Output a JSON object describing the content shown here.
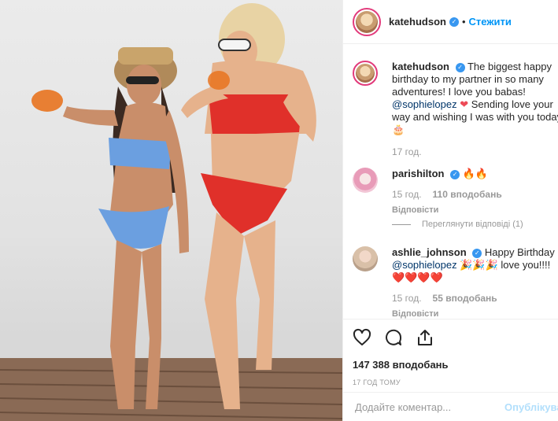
{
  "post": {
    "image_alt": "Two women in bikinis holding drinks against a white wall",
    "author": "katehudson",
    "follow_label": "Стежити"
  },
  "caption": {
    "user": "katehudson",
    "text_1": "The biggest happy birthday to my partner in so many adventures! I love you babas!",
    "mention": "@sophielopez",
    "text_2": "Sending love your way and wishing I was with you today!",
    "emoji_end": "🎂",
    "time": "17 год."
  },
  "comments": [
    {
      "user": "parishilton",
      "text": "🔥🔥",
      "time": "15 год.",
      "likes": "110 вподобань",
      "reply_label": "Відповісти",
      "view_replies": "Переглянути відповіді (1)"
    },
    {
      "user": "ashlie_johnson",
      "text_1": "Happy Birthday",
      "mention": "@sophielopez",
      "text_2": "🎉🎉🎉 love you!!!! ❤️❤️❤️❤️",
      "time": "15 год.",
      "likes": "55 вподобань",
      "reply_label": "Відповісти"
    }
  ],
  "stats": {
    "likes": "147 388 вподобань",
    "time_ago": "17 ГОД ТОМУ"
  },
  "composer": {
    "placeholder": "Додайте коментар...",
    "publish_label": "Опублікувати"
  },
  "icons": [
    "heart-icon",
    "comment-icon",
    "share-icon"
  ],
  "colors": {
    "accent": "#0095f6",
    "verified": "#3897f0",
    "story_ring": "#e23a7b",
    "muted": "#999999"
  }
}
